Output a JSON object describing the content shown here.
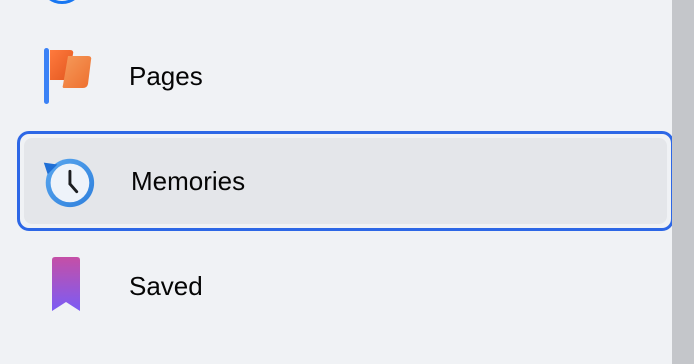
{
  "menu": {
    "items": [
      {
        "label": "Pages",
        "icon": "flag-icon"
      },
      {
        "label": "Memories",
        "icon": "clock-history-icon",
        "focused": true
      },
      {
        "label": "Saved",
        "icon": "bookmark-icon"
      }
    ]
  },
  "colors": {
    "background": "#f0f2f5",
    "focus_ring": "#2d67e6",
    "hover_bg": "#e4e6ea",
    "text": "#050505"
  }
}
